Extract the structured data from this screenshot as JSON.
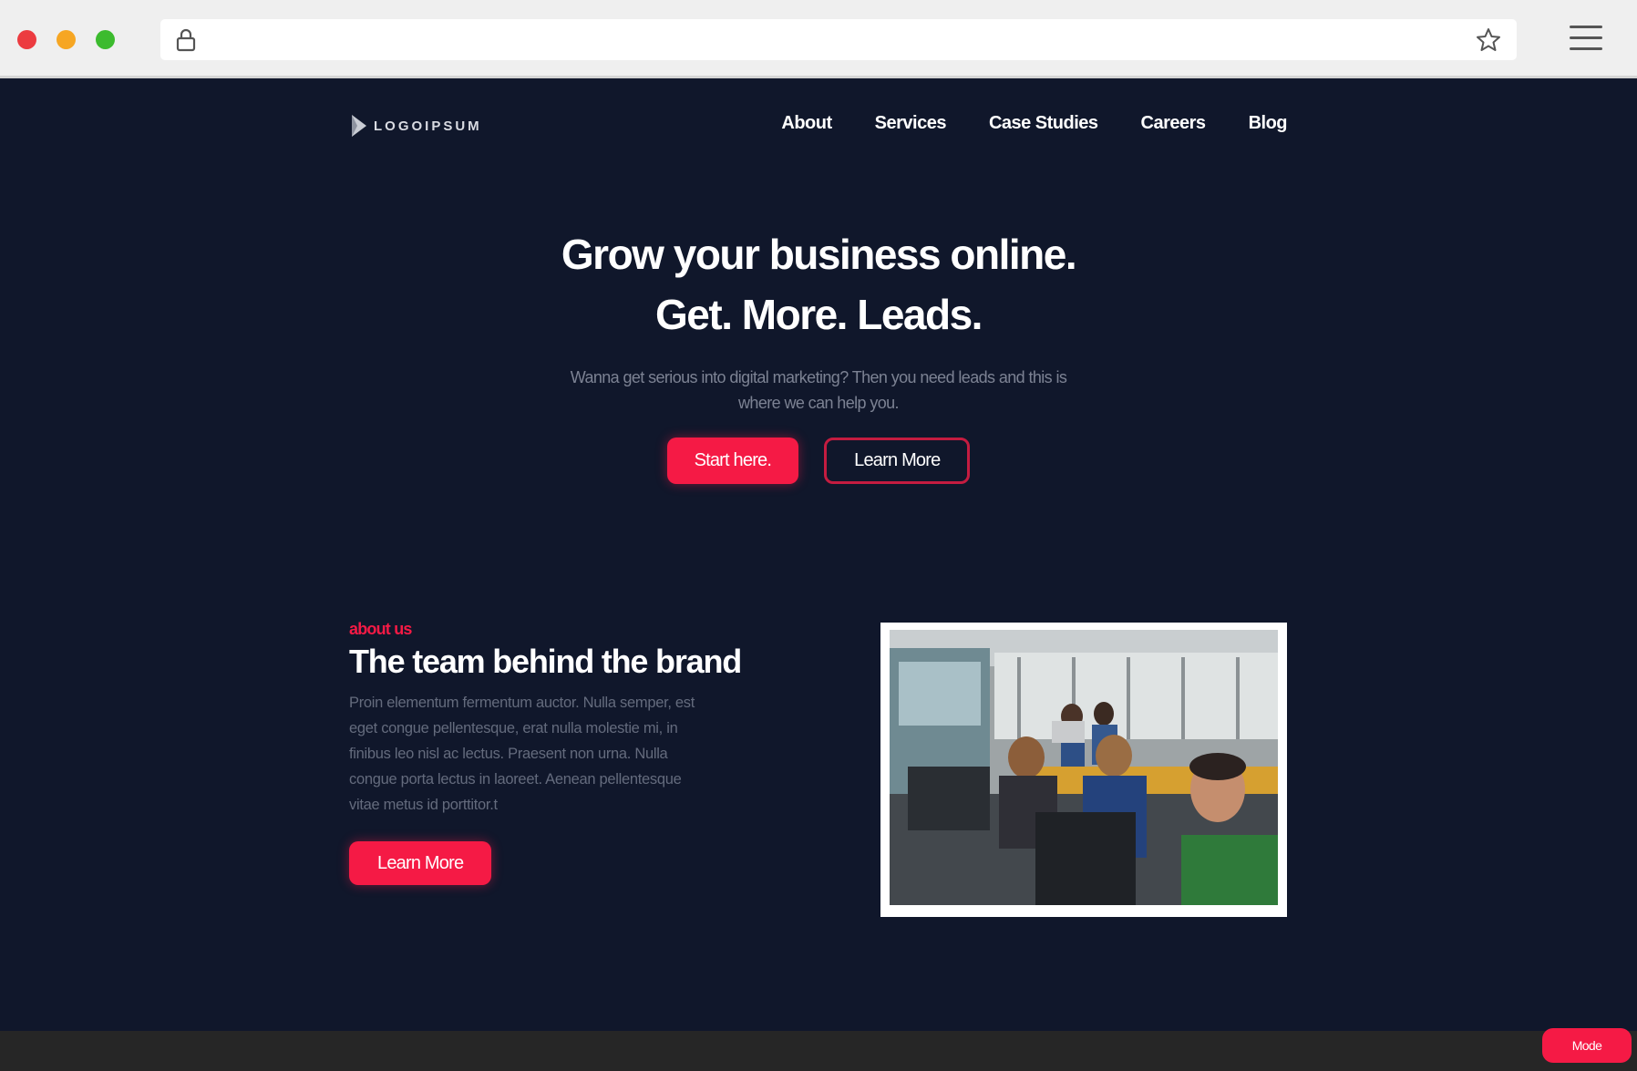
{
  "browser": {
    "icons": {
      "lock": "lock-icon",
      "star": "star-icon",
      "menu": "hamburger-icon"
    }
  },
  "nav": {
    "logo_text": "LOGOIPSUM",
    "links": [
      "About",
      "Services",
      "Case Studies",
      "Careers",
      "Blog"
    ]
  },
  "hero": {
    "title_line1": "Grow your business online.",
    "title_line2": "Get. More. Leads.",
    "subtitle": "Wanna get serious into digital marketing? Then you need leads and this is where we can help you.",
    "primary_button": "Start here.",
    "secondary_button": "Learn More"
  },
  "about": {
    "tag": "about us",
    "title": "The team behind the brand",
    "body": "Proin elementum fermentum auctor. Nulla semper, est eget congue pellentesque, erat nulla molestie mi, in finibus leo nisl ac lectus. Praesent non urna. Nulla congue porta lectus in laoreet. Aenean pellentesque vitae metus id porttitor.t",
    "button": "Learn More"
  },
  "mode_button": "Mode",
  "colors": {
    "background": "#10172b",
    "accent": "#f51a45",
    "footer": "#262626"
  }
}
